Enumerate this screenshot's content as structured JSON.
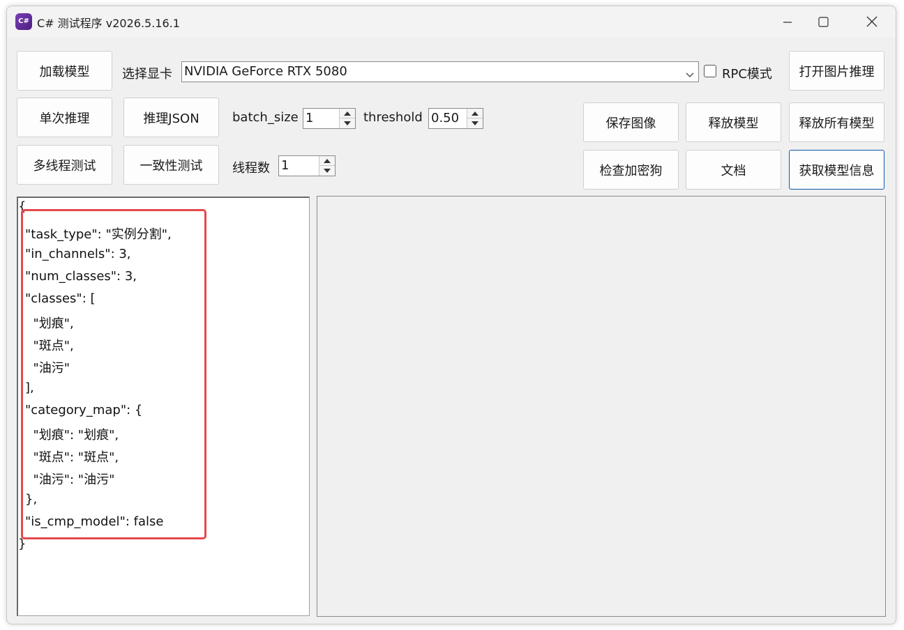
{
  "window": {
    "title": "C# 测试程序 v2026.5.16.1",
    "icon_label": "C#"
  },
  "toolbar": {
    "load_model": "加载模型",
    "select_gpu_label": "选择显卡",
    "gpu_value": "NVIDIA GeForce RTX 5080",
    "rpc_mode_label": "RPC模式",
    "rpc_mode_checked": false,
    "open_image_infer": "打开图片推理",
    "single_infer": "单次推理",
    "infer_json": "推理JSON",
    "batch_size_label": "batch_size",
    "batch_size_value": "1",
    "threshold_label": "threshold",
    "threshold_value": "0.50",
    "save_image": "保存图像",
    "release_model": "释放模型",
    "release_all_models": "释放所有模型",
    "multithread_test": "多线程测试",
    "consistency_test": "一致性测试",
    "threads_label": "线程数",
    "threads_value": "1",
    "check_dongle": "检查加密狗",
    "docs": "文档",
    "get_model_info": "获取模型信息"
  },
  "json_output": {
    "lines": [
      "{",
      "\"task_type\": \"实例分割\",",
      "\"in_channels\": 3,",
      "\"num_classes\": 3,",
      "\"classes\": [",
      "  \"划痕\",",
      "  \"斑点\",",
      "  \"油污\"",
      "],",
      "\"category_map\": {",
      "  \"划痕\": \"划痕\",",
      "  \"斑点\": \"斑点\",",
      "  \"油污\": \"油污\"",
      "},",
      "\"is_cmp_model\": false",
      "}"
    ]
  },
  "colors": {
    "highlight_border": "#e5484d",
    "focused_button_border": "#0b5aa8"
  }
}
